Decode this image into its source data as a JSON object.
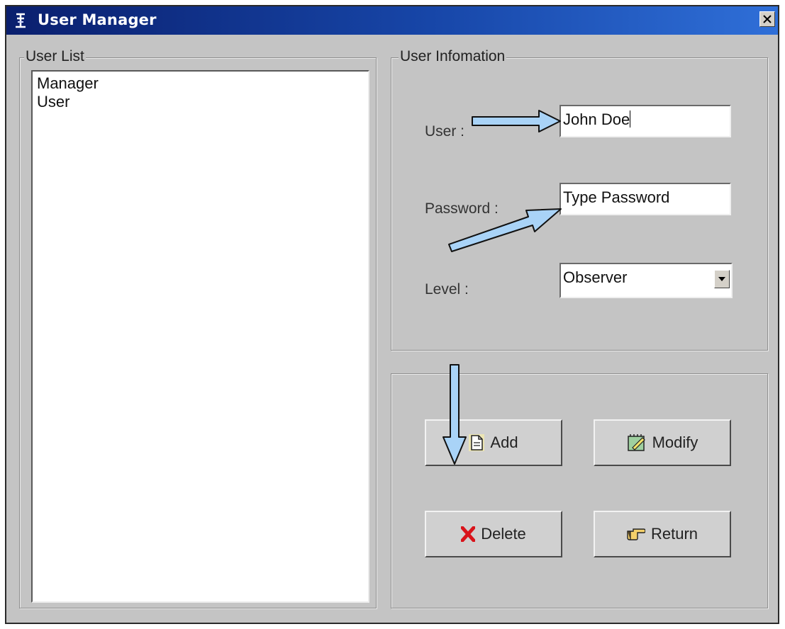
{
  "window": {
    "title": "User Manager",
    "close_glyph": "×"
  },
  "user_list": {
    "legend": "User List",
    "items": [
      "Manager",
      "User"
    ]
  },
  "user_info": {
    "legend": "User Infomation",
    "user_label": "User :",
    "user_value": "John Doe",
    "password_label": "Password :",
    "password_value": "Type Password",
    "level_label": "Level :",
    "level_value": "Observer"
  },
  "buttons": {
    "add": "Add",
    "modify": "Modify",
    "delete": "Delete",
    "return": "Return"
  },
  "icons": {
    "app": "app-icon",
    "close": "close-icon",
    "dropdown": "chevron-down-icon",
    "add": "document-icon",
    "modify": "edit-icon",
    "delete": "x-icon",
    "return": "hand-pointer-icon"
  },
  "colors": {
    "arrow_fill": "#a9d3f7",
    "delete_red": "#d9131a"
  }
}
